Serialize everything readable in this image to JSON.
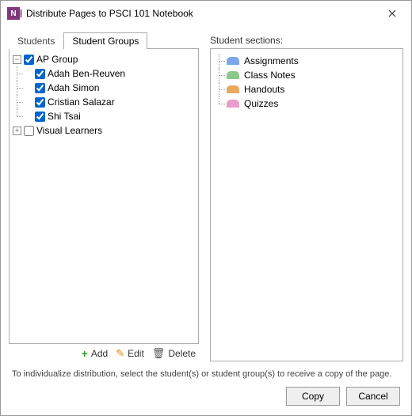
{
  "window": {
    "title": "Distribute Pages to PSCI 101 Notebook"
  },
  "tabs": [
    {
      "label": "Students",
      "active": false
    },
    {
      "label": "Student Groups",
      "active": true
    }
  ],
  "groups": [
    {
      "name": "AP Group",
      "expanded": true,
      "checked": true,
      "students": [
        {
          "name": "Adah Ben-Reuven",
          "checked": true
        },
        {
          "name": "Adah Simon",
          "checked": true
        },
        {
          "name": "Cristian Salazar",
          "checked": true
        },
        {
          "name": "Shi Tsai",
          "checked": true
        }
      ]
    },
    {
      "name": "Visual Learners",
      "expanded": false,
      "checked": false,
      "students": []
    }
  ],
  "toolbar": {
    "add": "Add",
    "edit": "Edit",
    "delete": "Delete"
  },
  "sections_label": "Student sections:",
  "sections": [
    {
      "name": "Assignments",
      "color": "c-blue"
    },
    {
      "name": "Class Notes",
      "color": "c-green"
    },
    {
      "name": "Handouts",
      "color": "c-orange"
    },
    {
      "name": "Quizzes",
      "color": "c-pink"
    }
  ],
  "hint": "To individualize distribution, select the student(s) or student group(s) to receive a copy of the page.",
  "footer": {
    "copy": "Copy",
    "cancel": "Cancel"
  }
}
